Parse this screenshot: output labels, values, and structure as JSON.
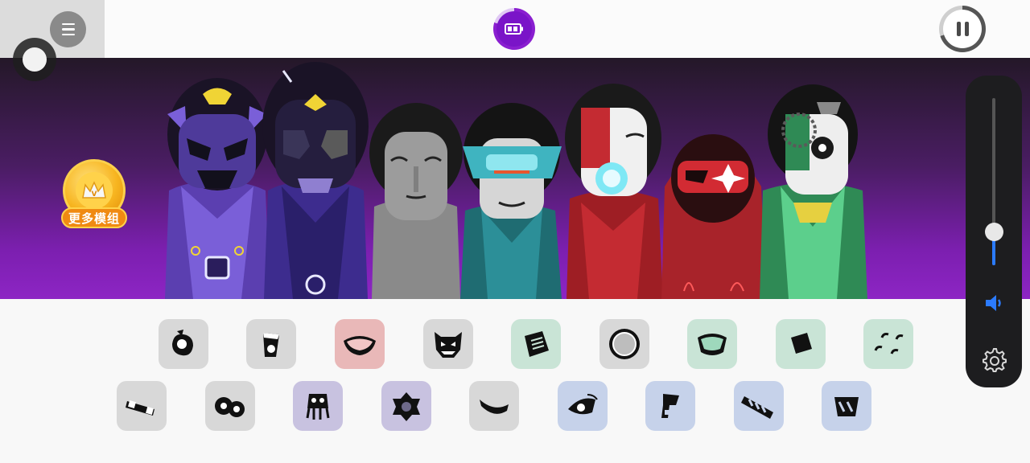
{
  "app": {
    "title": "",
    "more_mods_label": "更多模组",
    "colors": {
      "stage_top": "#241828",
      "stage_bottom": "#8d25c4",
      "accent_purple": "#7a14c8",
      "volume_accent": "#2b7bff",
      "panel_dark": "#1d1d1f"
    }
  },
  "topbar": {
    "menu_icon": "hamburger-menu-icon",
    "battery_icon": "battery-icon",
    "pause_icon": "pause-icon",
    "progress_fraction": 0.7
  },
  "volume": {
    "level_fraction": 0.2,
    "speaker_icon": "speaker-icon",
    "settings_icon": "gear-icon"
  },
  "characters": [
    {
      "id": "char-1",
      "theme": "purple-horned",
      "color": "#5b3fb0"
    },
    {
      "id": "char-2",
      "theme": "purple-masked",
      "color": "#3d2c8e"
    },
    {
      "id": "char-3",
      "theme": "grey-plain",
      "color": "#8a8a8a"
    },
    {
      "id": "char-4",
      "theme": "teal-visor",
      "color": "#2c7f86"
    },
    {
      "id": "char-5",
      "theme": "red-cyber",
      "color": "#b8232b"
    },
    {
      "id": "char-6",
      "theme": "red-hood",
      "color": "#b5282e"
    },
    {
      "id": "char-7",
      "theme": "green-jester",
      "color": "#3e9a62"
    }
  ],
  "sound_icons_row1": [
    {
      "name": "sound-icon-1",
      "bg": "#d8d8d8",
      "glyph": "blob"
    },
    {
      "name": "sound-icon-2",
      "bg": "#d8d8d8",
      "glyph": "cup"
    },
    {
      "name": "sound-icon-3",
      "bg": "#e9b8b8",
      "glyph": "lips"
    },
    {
      "name": "sound-icon-4",
      "bg": "#d8d8d8",
      "glyph": "monster"
    },
    {
      "name": "sound-icon-5",
      "bg": "#c9e4d6",
      "glyph": "slab"
    },
    {
      "name": "sound-icon-6",
      "bg": "#d8d8d8",
      "glyph": "gear"
    },
    {
      "name": "sound-icon-7",
      "bg": "#c9e4d6",
      "glyph": "bowl"
    },
    {
      "name": "sound-icon-8",
      "bg": "#c9e4d6",
      "glyph": "diamond"
    },
    {
      "name": "sound-icon-9",
      "bg": "#c9e4d6",
      "glyph": "drops"
    }
  ],
  "sound_icons_row2": [
    {
      "name": "sound-icon-10",
      "bg": "#d8d8d8",
      "glyph": "bone"
    },
    {
      "name": "sound-icon-11",
      "bg": "#d8d8d8",
      "glyph": "gears"
    },
    {
      "name": "sound-icon-12",
      "bg": "#c8c2e0",
      "glyph": "squid"
    },
    {
      "name": "sound-icon-13",
      "bg": "#c8c2e0",
      "glyph": "flower"
    },
    {
      "name": "sound-icon-14",
      "bg": "#d8d8d8",
      "glyph": "smile"
    },
    {
      "name": "sound-icon-15",
      "bg": "#c6d2ea",
      "glyph": "eye"
    },
    {
      "name": "sound-icon-16",
      "bg": "#c6d2ea",
      "glyph": "hammer"
    },
    {
      "name": "sound-icon-17",
      "bg": "#c6d2ea",
      "glyph": "stripes"
    },
    {
      "name": "sound-icon-18",
      "bg": "#c6d2ea",
      "glyph": "shield"
    }
  ]
}
